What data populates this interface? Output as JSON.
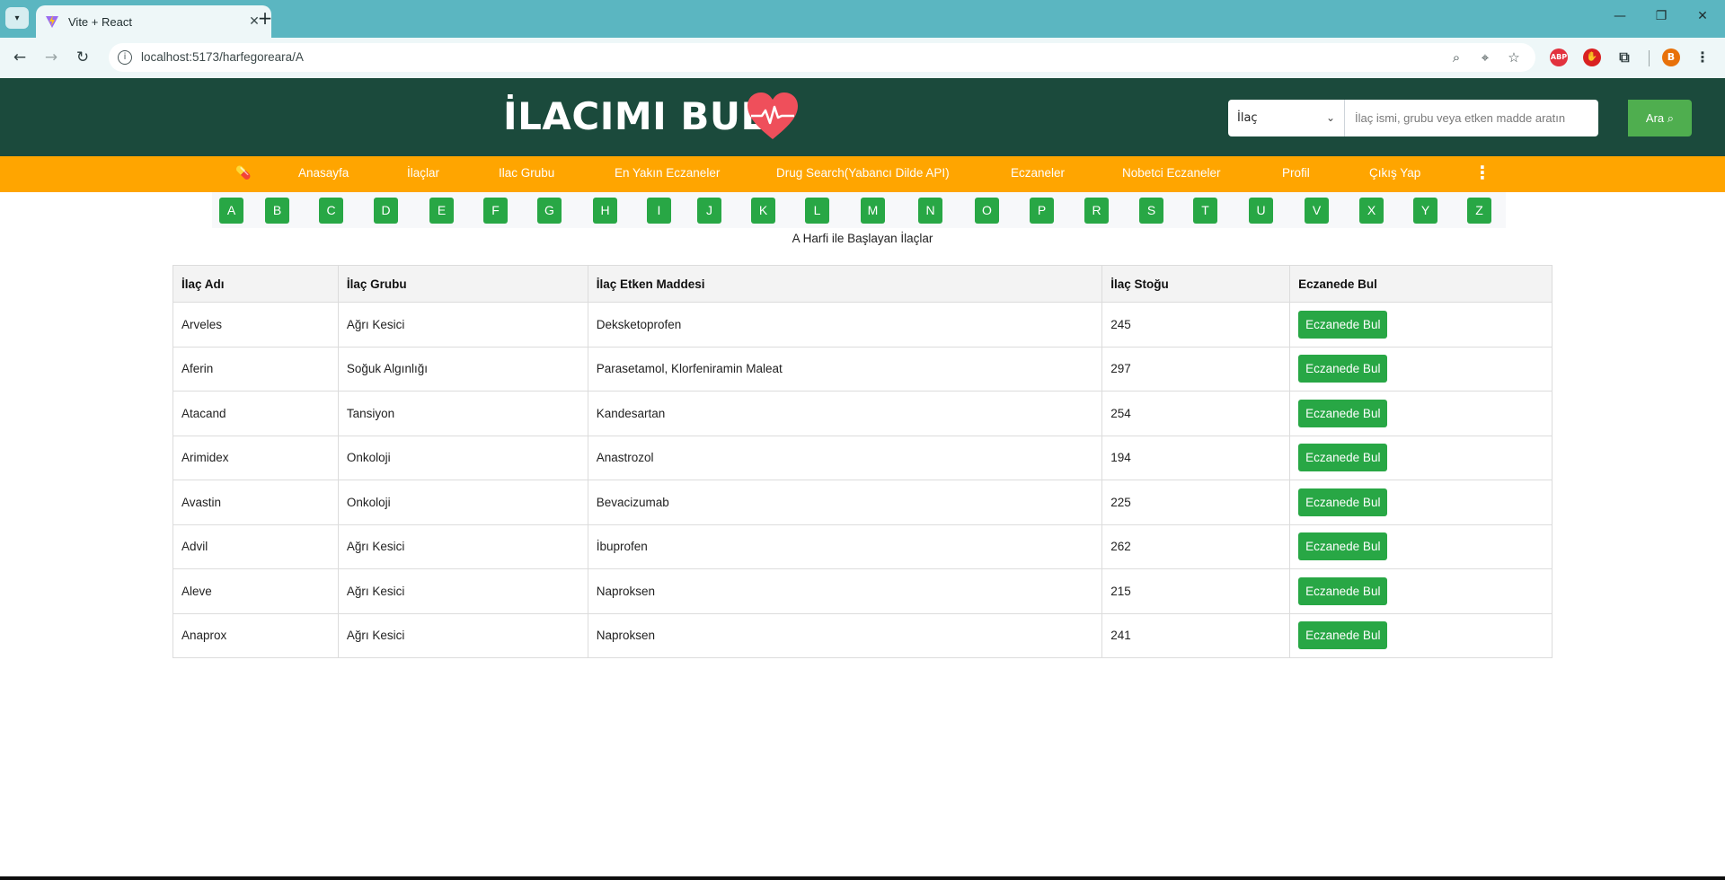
{
  "browser": {
    "tab_title": "Vite + React",
    "url": "localhost:5173/harfegoreara/A",
    "profile_initial": "B",
    "ext_abp": "ABP"
  },
  "header": {
    "brand": "İLACIMI BUL",
    "search": {
      "selected_option": "İlaç",
      "placeholder": "İlaç ismi, grubu veya etken madde aratın",
      "button_label": "Ara"
    }
  },
  "nav": {
    "items": [
      "Anasayfa",
      "İlaçlar",
      "Ilac Grubu",
      "En Yakın Eczaneler",
      "Drug Search(Yabancı Dilde API)",
      "Eczaneler",
      "Nobetci Eczaneler",
      "Profil",
      "Çıkış Yap"
    ]
  },
  "letters": [
    "A",
    "B",
    "C",
    "D",
    "E",
    "F",
    "G",
    "H",
    "I",
    "J",
    "K",
    "L",
    "M",
    "N",
    "O",
    "P",
    "R",
    "S",
    "T",
    "U",
    "V",
    "X",
    "Y",
    "Z"
  ],
  "caption": "A Harfi ile Başlayan İlaçlar",
  "table": {
    "headers": [
      "İlaç Adı",
      "İlaç Grubu",
      "İlaç Etken Maddesi",
      "İlaç Stoğu",
      "Eczanede Bul"
    ],
    "button_label": "Eczanede Bul",
    "rows": [
      {
        "name": "Arveles",
        "group": "Ağrı Kesici",
        "active": "Deksketoprofen",
        "stock": "245"
      },
      {
        "name": "Aferin",
        "group": "Soğuk Algınlığı",
        "active": "Parasetamol, Klorfeniramin Maleat",
        "stock": "297"
      },
      {
        "name": "Atacand",
        "group": "Tansiyon",
        "active": "Kandesartan",
        "stock": "254"
      },
      {
        "name": "Arimidex",
        "group": "Onkoloji",
        "active": "Anastrozol",
        "stock": "194"
      },
      {
        "name": "Avastin",
        "group": "Onkoloji",
        "active": "Bevacizumab",
        "stock": "225"
      },
      {
        "name": "Advil",
        "group": "Ağrı Kesici",
        "active": "İbuprofen",
        "stock": "262"
      },
      {
        "name": "Aleve",
        "group": "Ağrı Kesici",
        "active": "Naproksen",
        "stock": "215"
      },
      {
        "name": "Anaprox",
        "group": "Ağrı Kesici",
        "active": "Naproksen",
        "stock": "241"
      }
    ]
  },
  "colors": {
    "header_bg": "#1b4a3c",
    "nav_bg": "#ffa500",
    "letter_btn": "#28a745",
    "search_btn": "#4fae4f",
    "heart": "#ef4f5b"
  }
}
